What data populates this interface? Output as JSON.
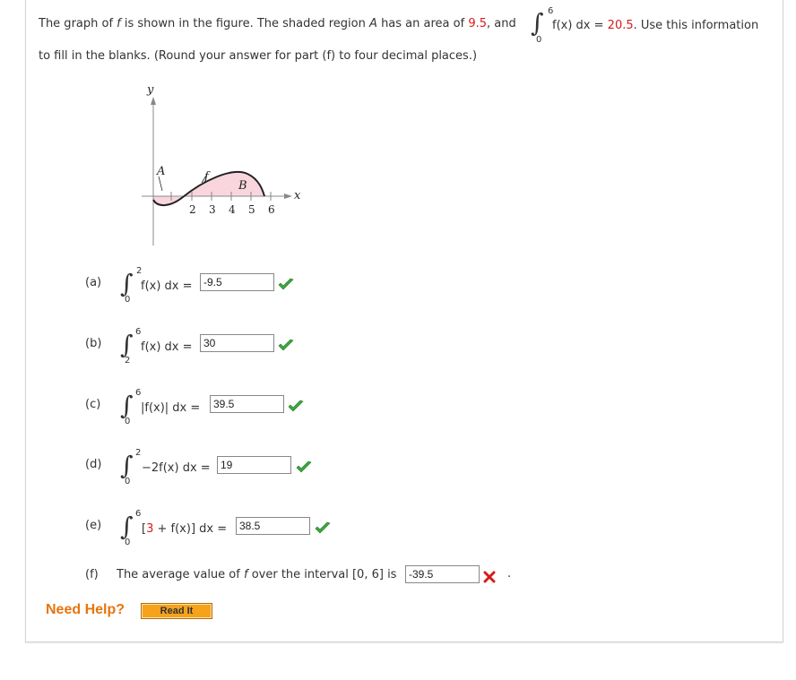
{
  "question": {
    "intro_1": "The graph of",
    "f": "f",
    "intro_2": "is shown in the figure. The shaded region",
    "A": "A",
    "intro_3": "has an area of",
    "area_value": "9.5",
    "intro_4": ", and",
    "int_upper": "6",
    "int_lower": "0",
    "int_expr": "f(x) dx =",
    "int_value": "20.5",
    "intro_5": ". Use this information",
    "line2": "to fill in the blanks. (Round your answer for part (f) to four decimal places.)"
  },
  "graph": {
    "y_label": "y",
    "x_label": "x",
    "A_label": "A",
    "B_label": "B",
    "f_label": "f",
    "ticks": [
      "2",
      "3",
      "4",
      "5",
      "6"
    ]
  },
  "parts": {
    "a": {
      "label": "(a)",
      "upper": "2",
      "lower": "0",
      "expr": "f(x) dx =",
      "answer": "-9.5",
      "status": "correct"
    },
    "b": {
      "label": "(b)",
      "upper": "6",
      "lower": "2",
      "expr": "f(x) dx =",
      "answer": "30",
      "status": "correct"
    },
    "c": {
      "label": "(c)",
      "upper": "6",
      "lower": "0",
      "expr": "|f(x)| dx =",
      "answer": "39.5",
      "status": "correct"
    },
    "d": {
      "label": "(d)",
      "upper": "2",
      "lower": "0",
      "expr": "−2f(x) dx =",
      "answer": "19",
      "status": "correct"
    },
    "e": {
      "label": "(e)",
      "upper": "6",
      "lower": "0",
      "expr_open": "[3 +",
      "expr_rest": "f(x)] dx =",
      "three": "3",
      "answer": "38.5",
      "status": "correct"
    },
    "f": {
      "label": "(f)",
      "text_1": "The average value of",
      "f": "f",
      "text_2": "over the interval [0, 6] is",
      "answer": "-39.5",
      "period": ".",
      "status": "incorrect"
    }
  },
  "help": {
    "label": "Need Help?",
    "read_it": "Read It"
  },
  "colors": {
    "correct": "#3aa83a",
    "incorrect": "#d81b1b",
    "highlight": "#d81b1b",
    "help": "#e8740c",
    "read_it_bg": "#f6a21b",
    "shade": "#f9d5de"
  }
}
